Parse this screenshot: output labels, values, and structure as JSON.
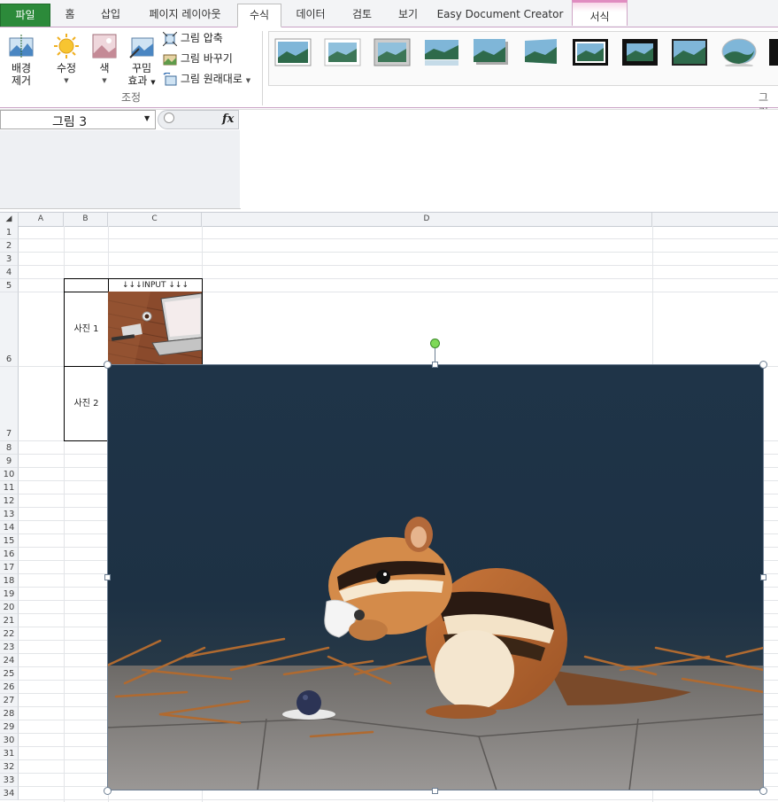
{
  "tabs": {
    "file": "파일",
    "home": "홈",
    "insert": "삽입",
    "page_layout": "페이지 레이아웃",
    "formulas": "수식",
    "data": "데이터",
    "review": "검토",
    "view": "보기",
    "easy_doc": "Easy Document Creator",
    "format": "서식"
  },
  "ribbon": {
    "remove_bg": [
      "배경",
      "제거"
    ],
    "corrections": "수정",
    "color": "색",
    "artistic": [
      "꾸밈",
      "효과"
    ],
    "compress": "그림 압축",
    "change": "그림 바꾸기",
    "reset": "그림 원래대로",
    "adjust_group": "조정",
    "styles_group": "그림"
  },
  "formula_bar": {
    "name_box": "그림 3",
    "fx": "fx"
  },
  "columns": [
    "A",
    "B",
    "C",
    "D"
  ],
  "rows": [
    "1",
    "2",
    "3",
    "4",
    "5",
    "6",
    "7",
    "8",
    "9",
    "10",
    "11",
    "12",
    "13",
    "14",
    "15",
    "16",
    "17",
    "18",
    "19",
    "20",
    "21",
    "22",
    "23",
    "24",
    "25",
    "26",
    "27",
    "28",
    "29",
    "30",
    "31",
    "32",
    "33",
    "34"
  ],
  "cells": {
    "c5": "↓↓↓INPUT ↓↓↓",
    "b6": "사진 1",
    "b7": "사진 2"
  },
  "colors": {
    "file_tab": "#2c8a3a",
    "context_accent": "#e08cc0",
    "rotate_handle": "#7ed957"
  }
}
